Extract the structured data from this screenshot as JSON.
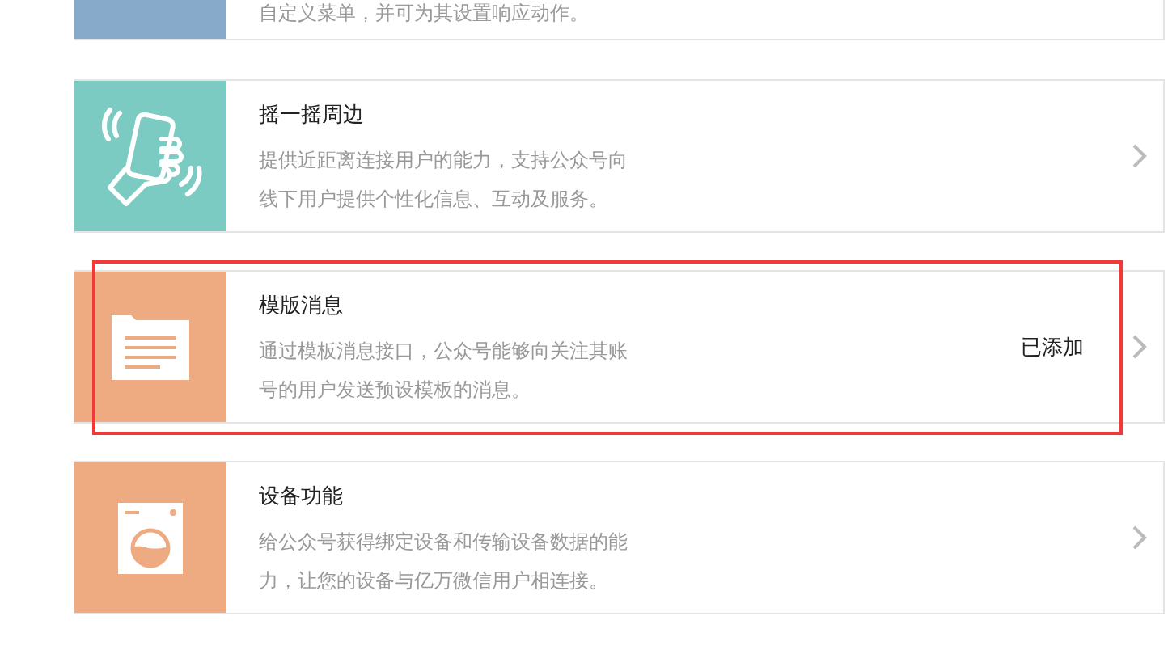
{
  "items": [
    {
      "kind": "menu",
      "color": "#87aacb",
      "description": "自定义菜单，并可为其设置响应动作。",
      "highlighted": false
    },
    {
      "kind": "shake",
      "color": "#7ccbc3",
      "title": "摇一摇周边",
      "description": "提供近距离连接用户的能力，支持公众号向线下用户提供个性化信息、互动及服务。",
      "highlighted": false
    },
    {
      "kind": "template",
      "color": "#eeaa80",
      "title": "模版消息",
      "description": "通过模板消息接口，公众号能够向关注其账号的用户发送预设模板的消息。",
      "status": "已添加",
      "highlighted": true
    },
    {
      "kind": "device",
      "color": "#eeaa80",
      "title": "设备功能",
      "description": "给公众号获得绑定设备和传输设备数据的能力，让您的设备与亿万微信用户相连接。",
      "highlighted": false
    }
  ]
}
